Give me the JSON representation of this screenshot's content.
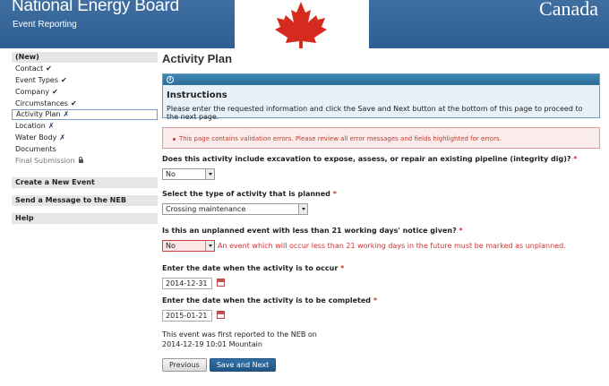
{
  "header": {
    "org_name": "National Energy Board",
    "subtitle": "Event Reporting",
    "wordmark": "Canada"
  },
  "sidebar": {
    "section_label": "(New)",
    "items": [
      {
        "label": "Contact",
        "mark": "✔"
      },
      {
        "label": "Event Types",
        "mark": "✔"
      },
      {
        "label": "Company",
        "mark": "✔"
      },
      {
        "label": "Circumstances",
        "mark": "✔"
      },
      {
        "label": "Activity Plan",
        "mark": "✗"
      },
      {
        "label": "Location",
        "mark": "✗"
      },
      {
        "label": "Water Body",
        "mark": "✗"
      },
      {
        "label": "Documents",
        "mark": ""
      },
      {
        "label": "Final Submission",
        "mark": ""
      }
    ],
    "create_event": "Create a New Event",
    "send_message": "Send a Message to the NEB",
    "help": "Help"
  },
  "main": {
    "title": "Activity Plan",
    "instructions_title": "Instructions",
    "instructions_text": "Please enter the requested information and click the Save and Next button at the bottom of this page to proceed to the next page.",
    "validation_error": "This page contains validation errors. Please review all error messages and fields highlighted for errors.",
    "q1": "Does this activity include excavation to expose, assess, or repair an existing pipeline (integrity dig)?",
    "q1_value": "No",
    "q2": "Select the type of activity that is planned",
    "q2_value": "Crossing maintenance",
    "q3": "Is this an unplanned event with less than 21 working days' notice given?",
    "q3_value": "No",
    "q3_error": "An event which will occur less than 21 working days in the future must be marked as unplanned.",
    "q4": "Enter the date when the activity is to occur",
    "q4_value": "2014-12-31",
    "q5": "Enter the date when the activity is to be completed",
    "q5_value": "2015-01-21",
    "reported_line1": "This event was first reported to the NEB on",
    "reported_line2": "2014-12-19 10:01 Mountain",
    "required_mark": "*",
    "previous_label": "Previous",
    "save_next_label": "Save and Next"
  },
  "colors": {
    "header_blue": "#3f6fa0",
    "primary_button": "#2f6fa8",
    "error_red": "#c0392b",
    "leaf_red": "#d52b1e"
  }
}
